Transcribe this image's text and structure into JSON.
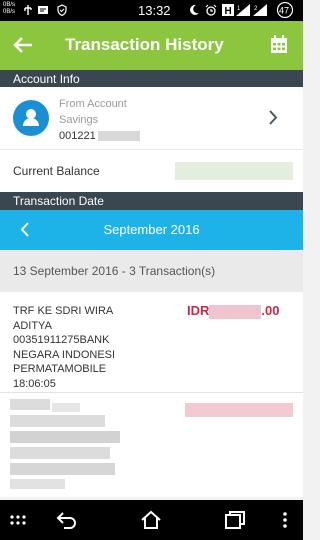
{
  "status_bar": {
    "net_up": "0B/s",
    "net_down": "0B/s",
    "time": "13:32",
    "battery": "47"
  },
  "app_bar": {
    "title": "Transaction History"
  },
  "account_info": {
    "section_title": "Account Info",
    "from_label": "From Account",
    "account_type": "Savings",
    "account_number_prefix": "001221"
  },
  "balance": {
    "label": "Current Balance"
  },
  "transaction_date": {
    "section_title": "Transaction Date",
    "month": "September 2016"
  },
  "day_group": {
    "header": "13 September 2016 - 3 Transaction(s)"
  },
  "transactions": [
    {
      "description_lines": [
        "TRF KE SDRI WIRA",
        "ADITYA",
        "00351911275BANK",
        "NEGARA INDONESI",
        "PERMATAMOBILE",
        "18:06:05"
      ],
      "amount_prefix": "IDR",
      "amount_suffix": ".00"
    }
  ],
  "colors": {
    "app_bar": "#8cc63f",
    "section_header": "#3a4750",
    "month_bar": "#1eb3e8",
    "amount": "#c82845",
    "avatar": "#1b8fd3"
  }
}
